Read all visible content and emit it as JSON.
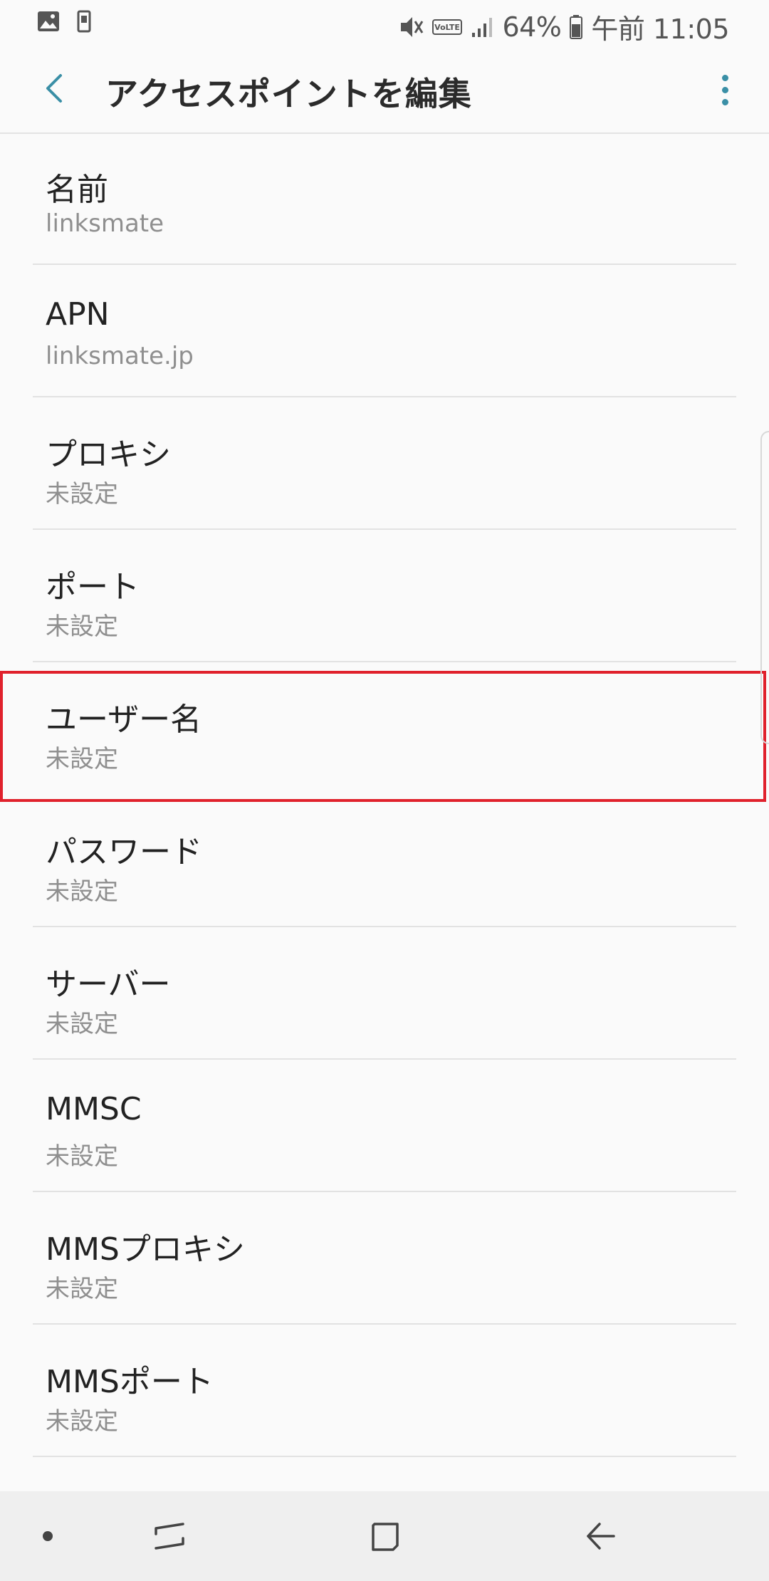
{
  "status_bar": {
    "battery": "64%",
    "time": "午前 11:05",
    "icons": [
      "gallery-icon",
      "phone-storage-icon",
      "mute-icon",
      "volte-icon",
      "signal-icon",
      "battery-icon"
    ]
  },
  "app_bar": {
    "title": "アクセスポイントを編集",
    "back_icon": "back-arrow-icon",
    "more_icon": "more-vert-icon"
  },
  "colors": {
    "accent": "#3a8fa6",
    "highlight": "#e0212c",
    "background": "#fafafa"
  },
  "items": [
    {
      "label": "名前",
      "value": "linksmate"
    },
    {
      "label": "APN",
      "value": "linksmate.jp"
    },
    {
      "label": "プロキシ",
      "value": "未設定"
    },
    {
      "label": "ポート",
      "value": "未設定"
    },
    {
      "label": "ユーザー名",
      "value": "未設定"
    },
    {
      "label": "パスワード",
      "value": "未設定"
    },
    {
      "label": "サーバー",
      "value": "未設定"
    },
    {
      "label": "MMSC",
      "value": "未設定"
    },
    {
      "label": "MMSプロキシ",
      "value": "未設定"
    },
    {
      "label": "MMSポート",
      "value": "未設定"
    }
  ],
  "nav_bar": {
    "icons": [
      "dot-indicator",
      "recents-icon",
      "home-icon",
      "back-icon"
    ]
  }
}
